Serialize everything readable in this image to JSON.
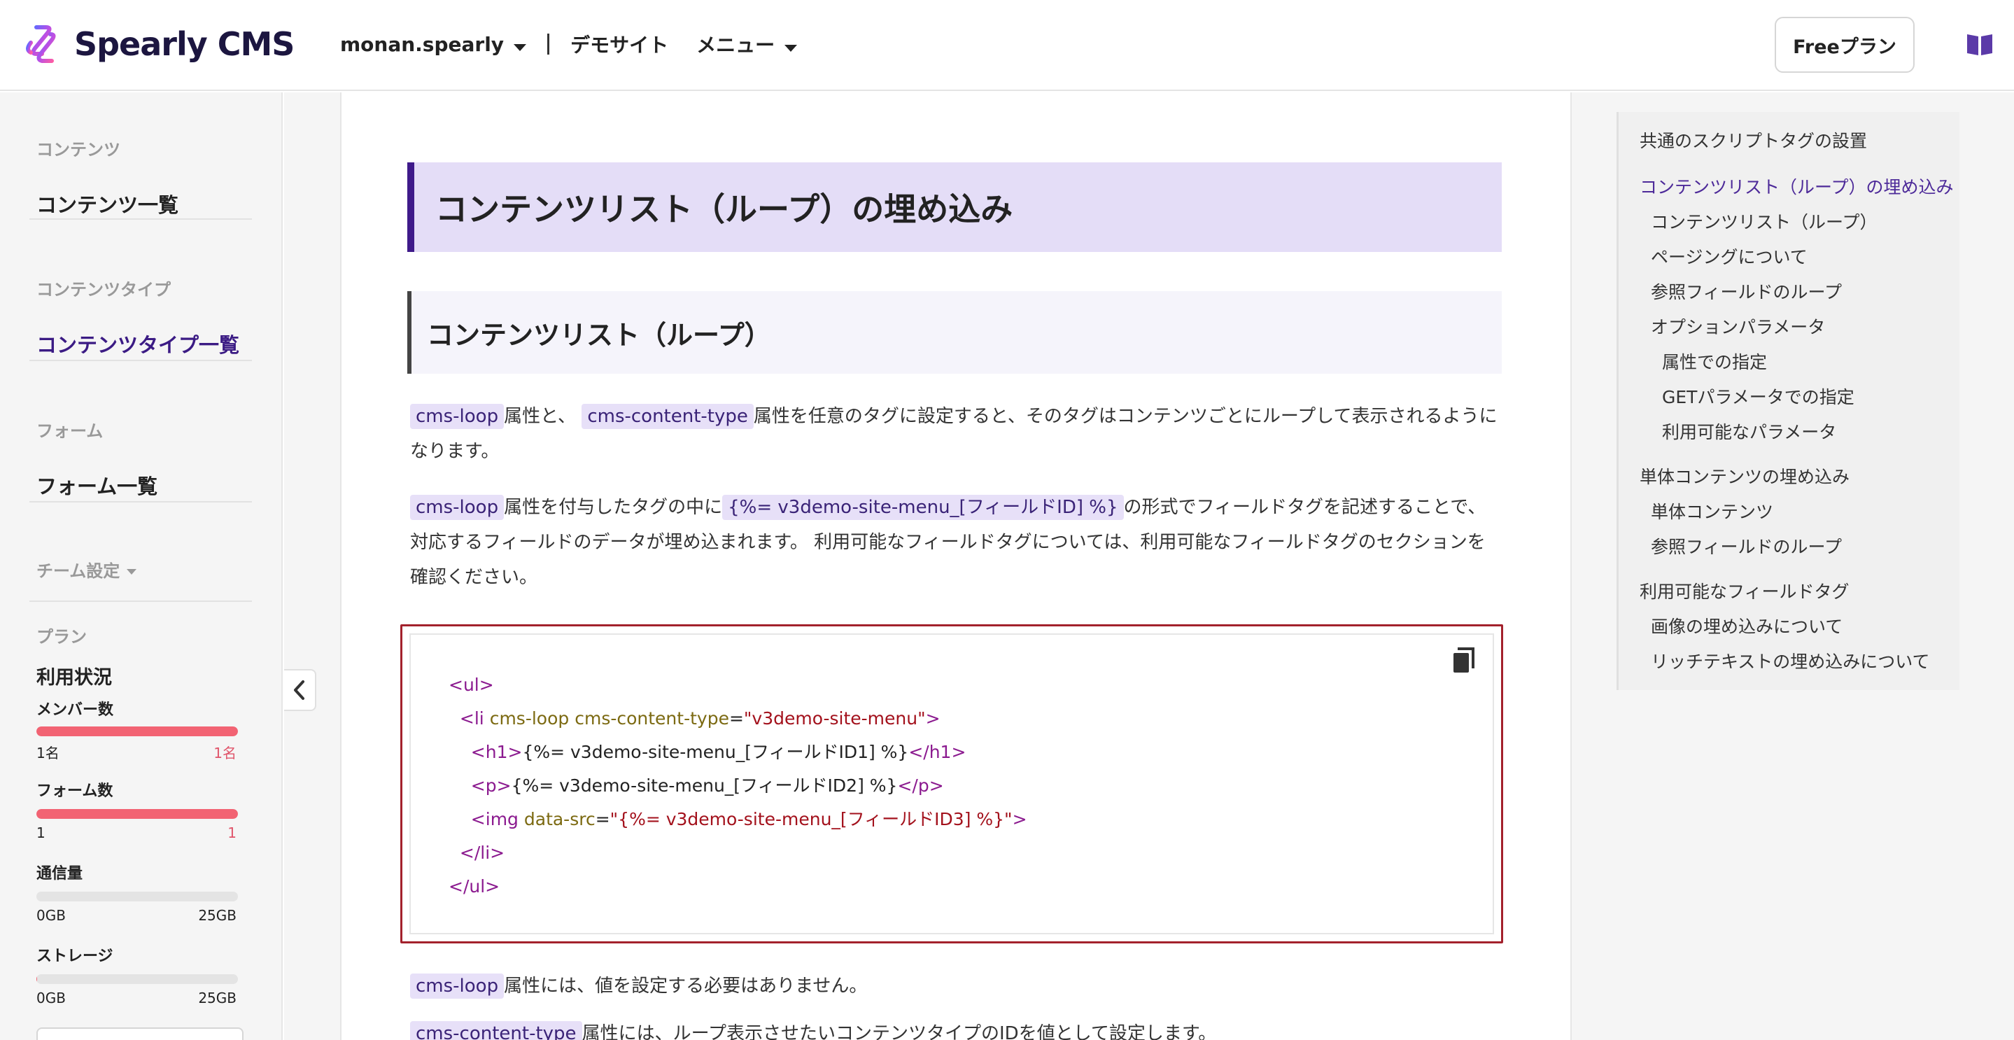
{
  "header": {
    "logo_text": "Spearly CMS",
    "team_name": "monan.spearly",
    "site_name": "デモサイト",
    "menu_label": "メニュー",
    "plan_button": "Freeプラン",
    "book_icon": "book-icon"
  },
  "sidebar": {
    "sections": [
      {
        "heading": "コンテンツ",
        "item": "コンテンツ一覧"
      },
      {
        "heading": "コンテンツタイプ",
        "item": "コンテンツタイプ一覧"
      },
      {
        "heading": "フォーム",
        "item": "フォーム一覧"
      }
    ],
    "team_settings": "チーム設定",
    "plan_heading": "プラン",
    "usage_title": "利用状況",
    "usage": [
      {
        "label": "メンバー数",
        "min": "1名",
        "max": "1名",
        "ratio": 1.0
      },
      {
        "label": "フォーム数",
        "min": "1",
        "max": "1",
        "ratio": 1.0
      },
      {
        "label": "通信量",
        "min": "0GB",
        "max": "25GB",
        "ratio": 0.0
      },
      {
        "label": "ストレージ",
        "min": "0GB",
        "max": "25GB",
        "ratio": 0.003
      }
    ],
    "colors": {
      "active": "#3b1b84",
      "bar_fill": "#f26373"
    }
  },
  "main": {
    "h1": "コンテンツリスト（ループ）の埋め込み",
    "h2": "コンテンツリスト（ループ）",
    "p1": {
      "tag1": "cms-loop",
      "t1": "属性と、",
      "tag2": "cms-content-type",
      "t2": "属性を任意のタグに設定すると、そのタグはコンテンツごとにループして表示されるようになります。"
    },
    "p2": {
      "tag1": "cms-loop",
      "t1": "属性を付与したタグの中に",
      "tag2": "{%= v3demo-site-menu_[フィールドID] %}",
      "t2": "の形式でフィールドタグを記述することで、対応するフィールドのデータが埋め込まれます。 利用可能なフィールドタグについては、利用可能なフィールドタグのセクションを確認ください。"
    },
    "code": {
      "l1_open": "<ul>",
      "l2_tag": "<li",
      "l2_attr1": "cms-loop",
      "l2_attr2": "cms-content-type",
      "l2_eq": "=",
      "l2_val": "\"v3demo-site-menu\"",
      "l2_close": ">",
      "l3_open": "<h1>",
      "l3_text": "{%= v3demo-site-menu_[フィールドID1] %}",
      "l3_close": "</h1>",
      "l4_open": "<p>",
      "l4_text": "{%= v3demo-site-menu_[フィールドID2] %}",
      "l4_close": "</p>",
      "l5_tag": "<img",
      "l5_attr": "data-src",
      "l5_eq": "=",
      "l5_val": "\"{%= v3demo-site-menu_[フィールドID3] %}\"",
      "l5_close": ">",
      "l6": "</li>",
      "l7": "</ul>"
    },
    "p3": {
      "tag1": "cms-loop",
      "t1": "属性には、値を設定する必要はありません。"
    },
    "p4": {
      "tag1": "cms-content-type",
      "t1": "属性には、ループ表示させたいコンテンツタイプのIDを値として設定します。"
    }
  },
  "toc": {
    "items": [
      {
        "label": "共通のスクリプトタグの設置",
        "level": 0
      },
      {
        "label": "コンテンツリスト（ループ）の埋め込み",
        "level": 0,
        "active": true
      },
      {
        "label": "コンテンツリスト（ループ）",
        "level": 1
      },
      {
        "label": "ページングについて",
        "level": 1
      },
      {
        "label": "参照フィールドのループ",
        "level": 1
      },
      {
        "label": "オプションパラメータ",
        "level": 1
      },
      {
        "label": "属性での指定",
        "level": 2
      },
      {
        "label": "GETパラメータでの指定",
        "level": 2
      },
      {
        "label": "利用可能なパラメータ",
        "level": 2
      },
      {
        "label": "単体コンテンツの埋め込み",
        "level": 0
      },
      {
        "label": "単体コンテンツ",
        "level": 1
      },
      {
        "label": "参照フィールドのループ",
        "level": 1
      },
      {
        "label": "利用可能なフィールドタグ",
        "level": 0
      },
      {
        "label": "画像の埋め込みについて",
        "level": 1
      },
      {
        "label": "リッチテキストの埋め込みについて",
        "level": 1
      }
    ],
    "active_color": "#4d2a99"
  }
}
